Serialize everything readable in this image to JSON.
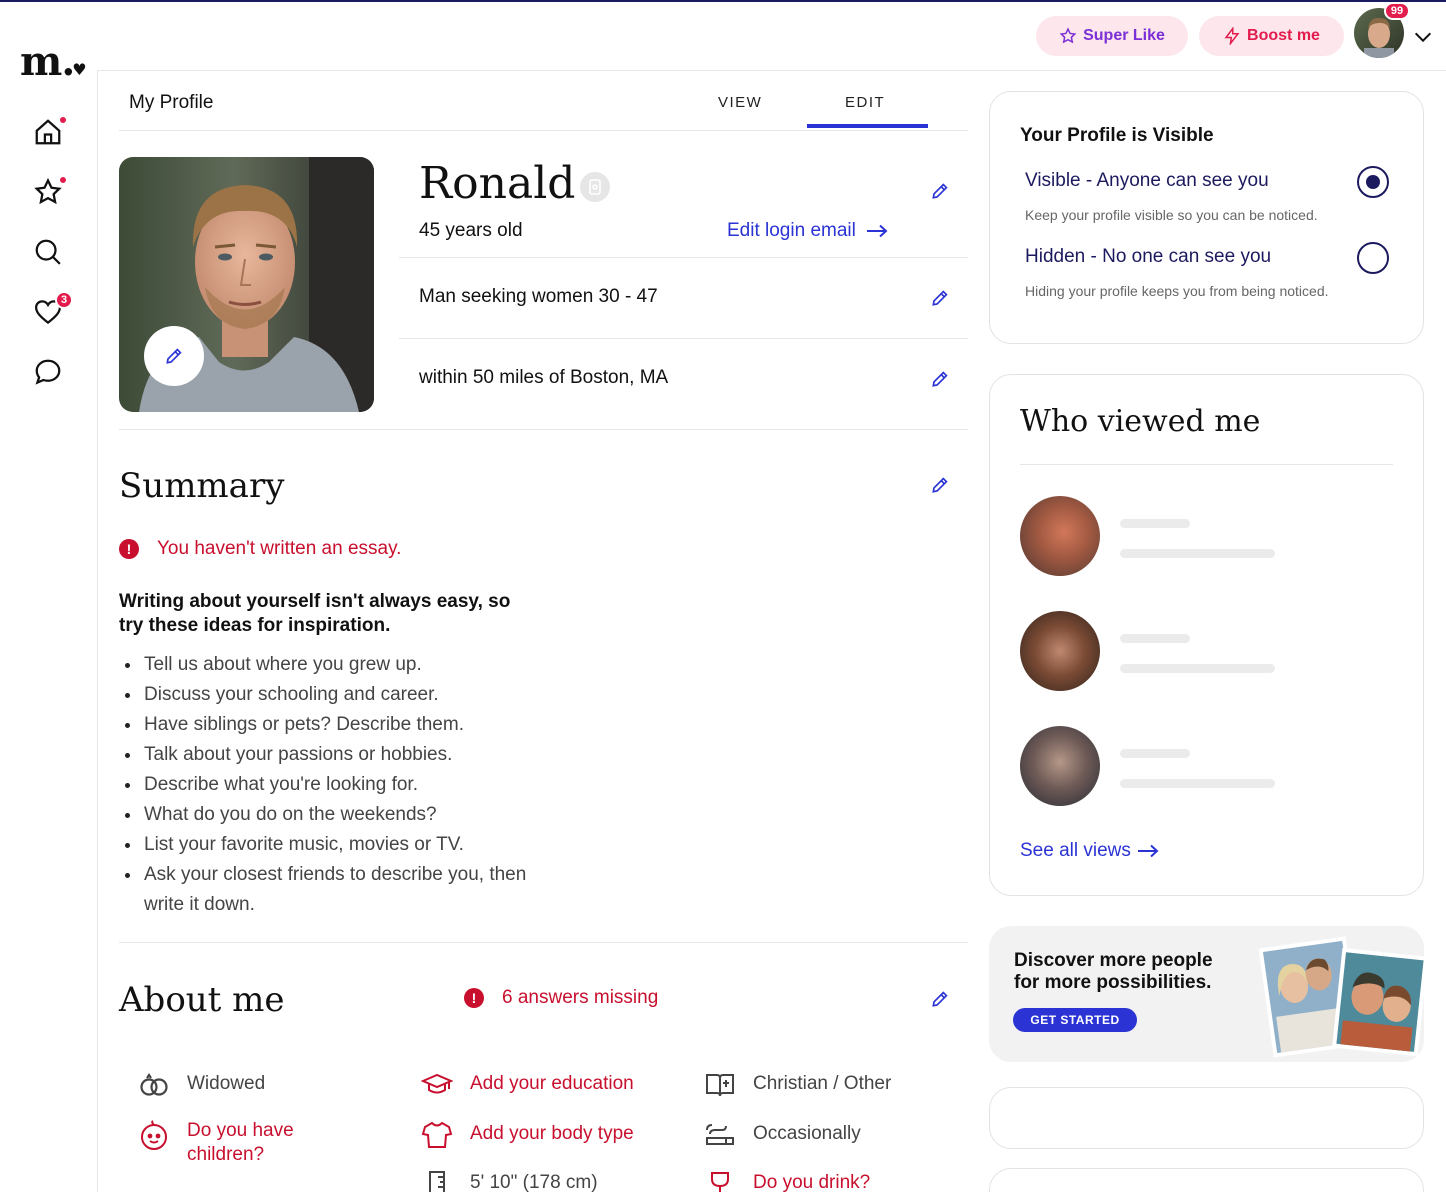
{
  "brand": {
    "logo_text": "m.",
    "logo_heart": "♥"
  },
  "nav": {
    "items": [
      {
        "name": "home",
        "icon": "home-icon",
        "indicator": "dot"
      },
      {
        "name": "standouts",
        "icon": "star-icon",
        "indicator": "dot"
      },
      {
        "name": "search",
        "icon": "search-icon"
      },
      {
        "name": "likes",
        "icon": "heart-icon",
        "badge": "3"
      },
      {
        "name": "messages",
        "icon": "chat-bubble-icon"
      }
    ]
  },
  "topbar": {
    "super_like": "Super Like",
    "boost": "Boost me",
    "avatar_badge": "99"
  },
  "profile_header": {
    "title": "My Profile",
    "tabs": [
      {
        "label": "VIEW"
      },
      {
        "label": "EDIT",
        "active": true
      }
    ]
  },
  "profile": {
    "name": "Ronald",
    "age": "45 years old",
    "edit_login_email": "Edit login email",
    "seeking": "Man seeking women 30 - 47",
    "location": "within 50 miles of Boston, MA"
  },
  "summary": {
    "title": "Summary",
    "warning": "You haven't written an essay.",
    "inspiration": "Writing about yourself isn't always easy, so try these ideas for inspiration.",
    "ideas": [
      "Tell us about where you grew up.",
      "Discuss your schooling and career.",
      "Have siblings or pets? Describe them.",
      "Talk about your passions or hobbies.",
      "Describe what you're looking for.",
      "What do you do on the weekends?",
      "List your favorite music, movies or TV.",
      "Ask your closest friends to describe you, then write it down."
    ]
  },
  "about": {
    "title": "About me",
    "missing": "6 answers missing",
    "items": [
      {
        "label": "Widowed",
        "icon": "rings-icon",
        "missing": false
      },
      {
        "label": "Add your education",
        "icon": "graduation-cap-icon",
        "missing": true
      },
      {
        "label": "Christian / Other",
        "icon": "book-icon",
        "missing": false
      },
      {
        "label": "Do you have children?",
        "icon": "baby-icon",
        "missing": true
      },
      {
        "label": "Add your body type",
        "icon": "shirt-icon",
        "missing": true
      },
      {
        "label": "Occasionally",
        "icon": "smoking-icon",
        "missing": false
      },
      {
        "label": "5' 10\" (178 cm)",
        "icon": "ruler-icon",
        "missing": false
      },
      {
        "label": "Do you drink?",
        "icon": "wine-glass-icon",
        "missing": true
      }
    ]
  },
  "visibility": {
    "title": "Your Profile is Visible",
    "options": [
      {
        "label": "Visible - Anyone can see you",
        "description": "Keep your profile visible so you can be noticed.",
        "selected": true
      },
      {
        "label": "Hidden - No one can see you",
        "description": "Hiding your profile keeps you from being noticed.",
        "selected": false
      }
    ]
  },
  "who_viewed": {
    "title": "Who viewed me",
    "see_all": "See all views"
  },
  "promo": {
    "text": "Discover more people for more possibilities.",
    "button": "GET STARTED"
  },
  "colors": {
    "accent_blue": "#2b33d4",
    "alert_red": "#c8102e",
    "badge_red": "#e31c4e",
    "navy": "#1c1a5e",
    "super_like_purple": "#7b2fd6",
    "pill_bg": "#fde7ec"
  }
}
